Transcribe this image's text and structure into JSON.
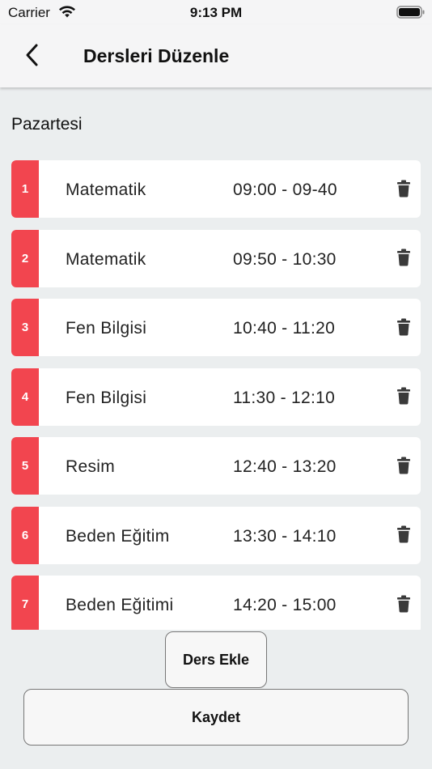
{
  "status_bar": {
    "carrier": "Carrier",
    "time": "9:13 PM"
  },
  "nav": {
    "title": "Dersleri Düzenle",
    "back_icon": "chevron-left-icon"
  },
  "day": "Pazartesi",
  "lessons": [
    {
      "index": "1",
      "name": "Matematik",
      "time": "09:00 - 09-40"
    },
    {
      "index": "2",
      "name": "Matematik",
      "time": "09:50 - 10:30"
    },
    {
      "index": "3",
      "name": "Fen Bilgisi",
      "time": "10:40 - 11:20"
    },
    {
      "index": "4",
      "name": "Fen Bilgisi",
      "time": "11:30 - 12:10"
    },
    {
      "index": "5",
      "name": "Resim",
      "time": "12:40 - 13:20"
    },
    {
      "index": "6",
      "name": "Beden Eğitim",
      "time": "13:30 - 14:10"
    },
    {
      "index": "7",
      "name": "Beden Eğitimi",
      "time": "14:20 - 15:00"
    }
  ],
  "buttons": {
    "add_lesson": "Ders Ekle",
    "save": "Kaydet"
  },
  "colors": {
    "accent": "#f2454f",
    "background": "#ebeeef",
    "row": "#ffffff",
    "icon": "#3a3a3a"
  },
  "icons": {
    "delete": "trash-icon",
    "wifi": "wifi-icon",
    "battery": "battery-icon"
  }
}
